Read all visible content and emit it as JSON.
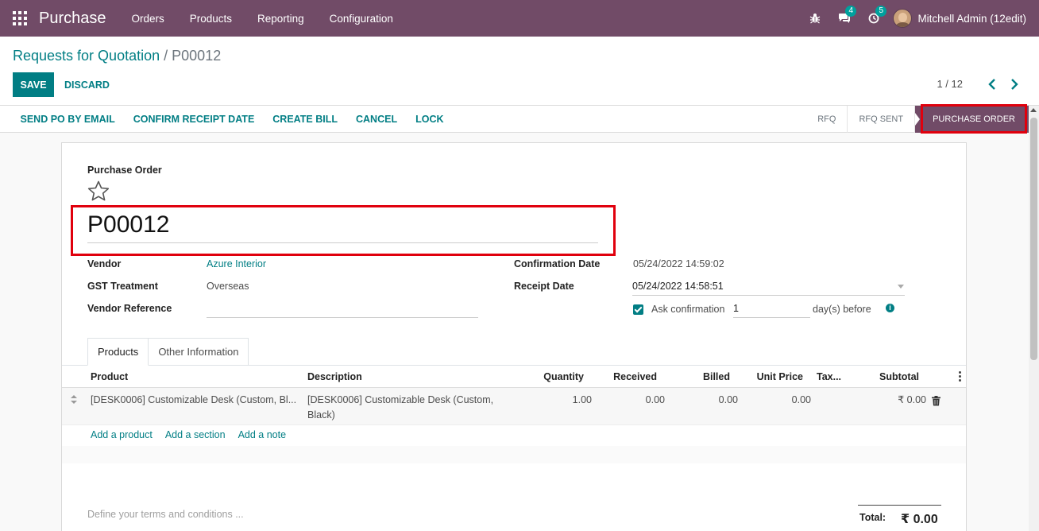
{
  "navbar": {
    "brand": "Purchase",
    "menu": [
      "Orders",
      "Products",
      "Reporting",
      "Configuration"
    ],
    "messages_count": "4",
    "activities_count": "5",
    "user": "Mitchell Admin (12edit)"
  },
  "control_panel": {
    "breadcrumb_parent": "Requests for Quotation",
    "breadcrumb_sep": "/",
    "breadcrumb_current": "P00012",
    "save_label": "SAVE",
    "discard_label": "DISCARD",
    "pager": "1 / 12"
  },
  "statusbar": {
    "buttons": [
      "SEND PO BY EMAIL",
      "CONFIRM RECEIPT DATE",
      "CREATE BILL",
      "CANCEL",
      "LOCK"
    ],
    "stages": [
      "RFQ",
      "RFQ SENT",
      "PURCHASE ORDER"
    ],
    "active_stage": "PURCHASE ORDER"
  },
  "form": {
    "title_label": "Purchase Order",
    "name": "P00012",
    "vendor_label": "Vendor",
    "vendor": "Azure Interior",
    "gst_label": "GST Treatment",
    "gst": "Overseas",
    "vendor_ref_label": "Vendor Reference",
    "vendor_ref": "",
    "confirmation_date_label": "Confirmation Date",
    "confirmation_date": "05/24/2022 14:59:02",
    "receipt_date_label": "Receipt Date",
    "receipt_date": "05/24/2022 14:58:51",
    "ask_confirmation_label": "Ask confirmation",
    "ask_confirmation_days": "1",
    "days_before_label": "day(s) before"
  },
  "tabs": [
    "Products",
    "Other Information"
  ],
  "order_lines": {
    "columns": [
      "Product",
      "Description",
      "Quantity",
      "Received",
      "Billed",
      "Unit Price",
      "Tax...",
      "Subtotal"
    ],
    "rows": [
      {
        "product": "[DESK0006] Customizable Desk (Custom, Bl...",
        "description_line1": "[DESK0006] Customizable Desk (Custom,",
        "description_line2": "Black)",
        "quantity": "1.00",
        "received": "0.00",
        "billed": "0.00",
        "unit_price": "0.00",
        "taxes": "",
        "subtotal": "₹ 0.00"
      }
    ],
    "add_product": "Add a product",
    "add_section": "Add a section",
    "add_note": "Add a note"
  },
  "footer": {
    "terms_placeholder": "Define your terms and conditions ...",
    "total_label": "Total:",
    "total_value": "₹ 0.00"
  },
  "colors": {
    "brand": "#714b67",
    "accent": "#017e84",
    "highlight": "#e0000d"
  }
}
